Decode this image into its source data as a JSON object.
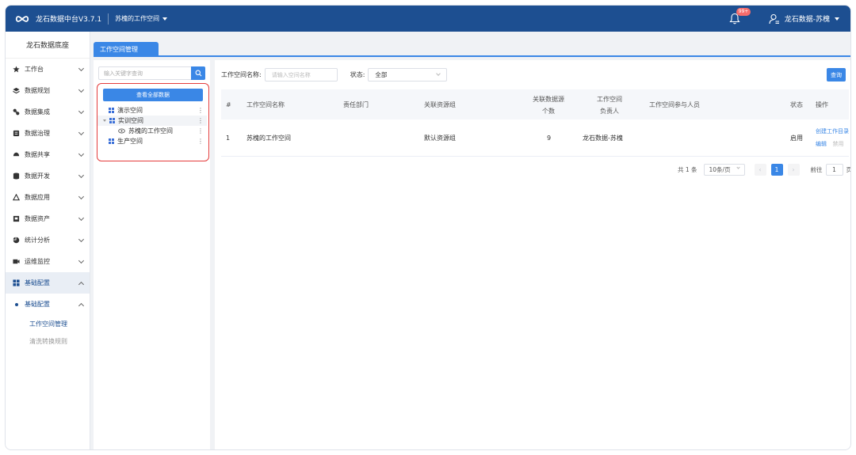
{
  "topbar": {
    "app_title": "龙石数据中台V3.7.1",
    "workspace": "苏槐的工作空间",
    "notify_badge": "99+",
    "user_name": "龙石数据-苏槐",
    "bg_color": "#1d4f91"
  },
  "sidebar": {
    "title": "龙石数据底座",
    "items": [
      {
        "label": "工作台",
        "icon": "star-icon"
      },
      {
        "label": "数据规划",
        "icon": "layers-icon"
      },
      {
        "label": "数据集成",
        "icon": "link-icon"
      },
      {
        "label": "数据治理",
        "icon": "governance-icon"
      },
      {
        "label": "数据共享",
        "icon": "share-icon"
      },
      {
        "label": "数据开发",
        "icon": "database-icon"
      },
      {
        "label": "数据应用",
        "icon": "app-icon"
      },
      {
        "label": "数据资产",
        "icon": "asset-icon"
      },
      {
        "label": "统计分析",
        "icon": "pie-icon"
      },
      {
        "label": "运维监控",
        "icon": "monitor-icon"
      },
      {
        "label": "基础配置",
        "icon": "grid-icon"
      }
    ],
    "sub_group": "基础配置",
    "sub_items": [
      "工作空间管理",
      "清洗转换规则"
    ]
  },
  "tabs": {
    "active": "工作空间管理"
  },
  "tree": {
    "search_placeholder": "输入关键字查询",
    "view_all": "查看全部数据",
    "nodes": [
      {
        "label": "演示空间"
      },
      {
        "label": "实训空间"
      },
      {
        "label": "苏槐的工作空间"
      },
      {
        "label": "生产空间"
      }
    ]
  },
  "filter": {
    "name_label": "工作空间名称:",
    "name_placeholder": "请输入空间名称",
    "status_label": "状态:",
    "status_value": "全部",
    "query": "查询"
  },
  "table": {
    "headers": {
      "index": "#",
      "name": "工作空间名称",
      "dept": "责任部门",
      "group": "关联资源组",
      "count_l1": "关联数据源",
      "count_l2": "个数",
      "owner_l1": "工作空间",
      "owner_l2": "负责人",
      "members": "工作空间参与人员",
      "status": "状态",
      "ops": "操作"
    },
    "rows": [
      {
        "index": "1",
        "name": "苏槐的工作空间",
        "dept": "",
        "group": "默认资源组",
        "count": "9",
        "owner": "龙石数据-苏槐",
        "members": "",
        "status": "启用",
        "op_create": "创建工作目录",
        "op_edit": "编辑",
        "op_disable": "禁用"
      }
    ]
  },
  "pager": {
    "total": "共 1 条",
    "page_size": "10条/页",
    "current_page": "1",
    "goto_label": "前往",
    "goto_value": "1",
    "page_unit": "页"
  }
}
